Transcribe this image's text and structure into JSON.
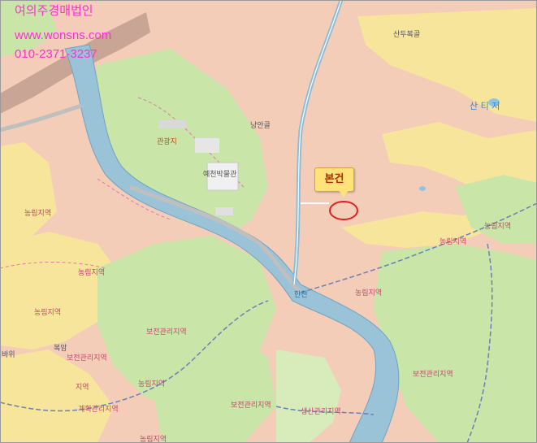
{
  "watermark": {
    "company": "여의주경매법인",
    "url": "www.wonsns.com",
    "phone": "010-2371-3237"
  },
  "callout": {
    "label": "본건"
  },
  "labels": {
    "sandubokgol": "산두복골",
    "sanjeongji": "산 티 저",
    "namangol": "낭안골",
    "museum": "예천박물관",
    "hyangyo": "관광지",
    "nongrim_1": "농림지역",
    "nongrim_2": "농림지역",
    "nongrim_3": "농림지역",
    "nongrim_4": "농림지역",
    "nongrim_5": "농림지역",
    "nongrim_6": "농림지역",
    "nongrim_7": "농림지역",
    "nongrim_8": "농림지역",
    "bojeon_1": "보전관리지역",
    "bojeon_2": "보전관리지역",
    "bojeon_3": "보전관리지역",
    "bojeon_4": "보전관리지역",
    "saengsan": "생산관리지역",
    "gyehoek": "계획관리지역",
    "bogam": "복암",
    "bawi": "바위",
    "river": "한천",
    "jiyeok_edge": "지역"
  }
}
